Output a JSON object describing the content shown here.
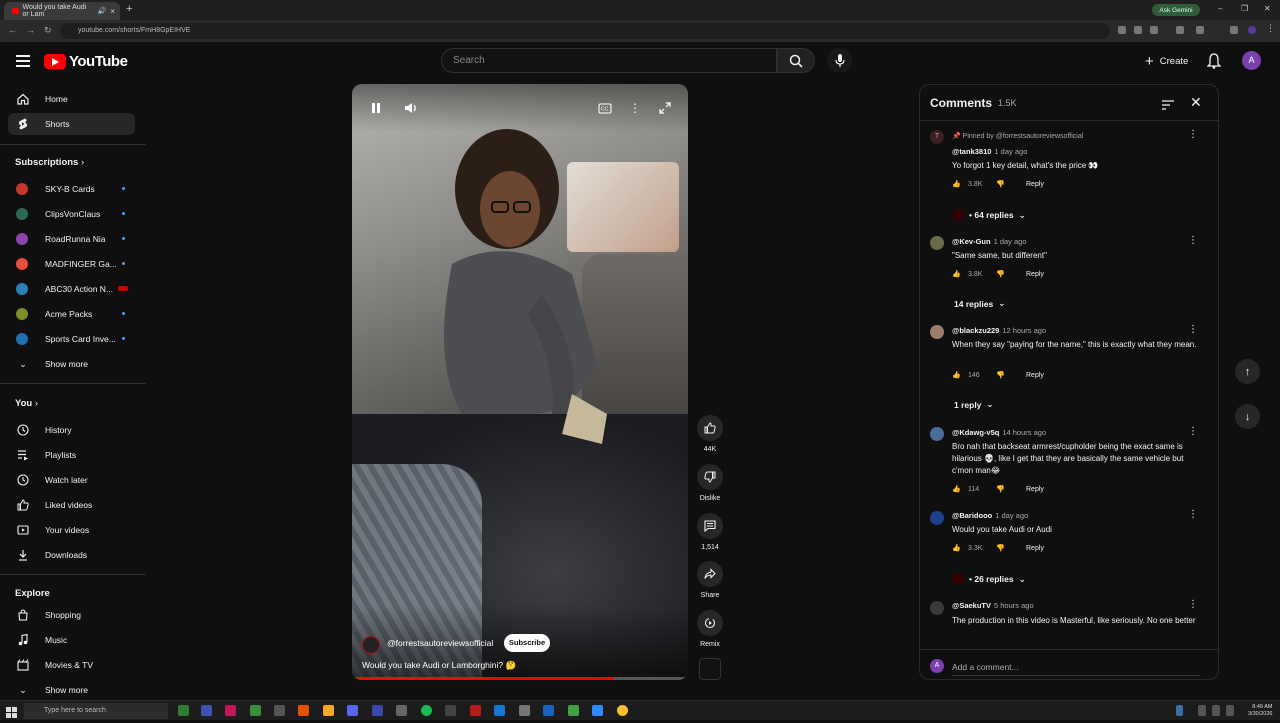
{
  "browser": {
    "tab_title": "Would you take Audi or Lam",
    "url": "youtube.com/shorts/FmH8GpEIHVE",
    "gemini_label": "Ask Gemini"
  },
  "header": {
    "logo_text": "YouTube",
    "search_placeholder": "Search",
    "create_label": "Create",
    "avatar_letter": "A"
  },
  "sidebar": {
    "main": [
      {
        "label": "Home",
        "icon": "home-icon"
      },
      {
        "label": "Shorts",
        "icon": "shorts-icon",
        "active": true
      }
    ],
    "subscriptions_heading": "Subscriptions",
    "subscriptions": [
      {
        "name": "SKY-B Cards",
        "color": "#c0392b"
      },
      {
        "name": "ClipsVonClaus",
        "color": "#2d6a4f"
      },
      {
        "name": "RoadRunna Nia",
        "color": "#8e44ad"
      },
      {
        "name": "MADFINGER Ga...",
        "color": "#e74c3c"
      },
      {
        "name": "ABC30 Action N...",
        "color": "#2980b9",
        "live": true
      },
      {
        "name": "Acme Packs",
        "color": "#7f8c2a"
      },
      {
        "name": "Sports Card Inve...",
        "color": "#1f6fb2"
      }
    ],
    "subs_show_more": "Show more",
    "you_heading": "You",
    "you_items": [
      {
        "label": "History",
        "icon": "history-icon"
      },
      {
        "label": "Playlists",
        "icon": "playlists-icon"
      },
      {
        "label": "Watch later",
        "icon": "watch-later-icon"
      },
      {
        "label": "Liked videos",
        "icon": "liked-videos-icon"
      },
      {
        "label": "Your videos",
        "icon": "your-videos-icon"
      },
      {
        "label": "Downloads",
        "icon": "downloads-icon"
      }
    ],
    "explore_heading": "Explore",
    "explore_items": [
      {
        "label": "Shopping",
        "icon": "shopping-icon"
      },
      {
        "label": "Music",
        "icon": "music-icon"
      },
      {
        "label": "Movies & TV",
        "icon": "movies-icon"
      }
    ],
    "explore_show_more": "Show more"
  },
  "video": {
    "channel": "@forrestsautoreviewsofficial",
    "subscribe_label": "Subscribe",
    "title": "Would you take Audi or Lamborghini? 🤔",
    "progress": 0.78
  },
  "actions": {
    "like_count": "44K",
    "dislike_label": "Dislike",
    "comment_count": "1,514",
    "share_label": "Share",
    "remix_label": "Remix"
  },
  "comments": {
    "heading": "Comments",
    "count": "1.5K",
    "pinned_label": "Pinned by @forrestsautoreviewsofficial",
    "items": [
      {
        "user": "@tank3810",
        "time": "1 day ago",
        "text": "Yo forgot 1 key detail, what's the price 👀",
        "likes": "3.8K",
        "replies": "• 64 replies",
        "avatar_color": "#5a2a2a",
        "avatar_letter": "T"
      },
      {
        "user": "@Kev-Gun",
        "time": "1 day ago",
        "text": "\"Same same, but different\"",
        "likes": "3.8K",
        "replies": "14 replies",
        "avatar_color": "#6b6b4a"
      },
      {
        "user": "@blackzu229",
        "time": "12 hours ago",
        "text": "When they say \"paying for the name,\" this is exactly what they mean.",
        "likes": "146",
        "replies": "1 reply",
        "avatar_color": "#9a7d6a"
      },
      {
        "user": "@Kdawg-v5q",
        "time": "14 hours ago",
        "text": "Bro nah that backseat armrest/cupholder being the exact same is hilarious 💀, like I get that they are basically the same vehicle but c'mon man😂",
        "likes": "114",
        "avatar_color": "#4a6c9a"
      },
      {
        "user": "@Baridooo",
        "time": "1 day ago",
        "text": "Would you take Audi or Audi",
        "likes": "3.3K",
        "replies": "• 26 replies",
        "avatar_color": "#1e3f8a"
      },
      {
        "user": "@SaekuTV",
        "time": "5 hours ago",
        "text": "The production in this video is Masterful, like seriously. No one better",
        "avatar_color": "#3a3a3a"
      }
    ],
    "reply_label": "Reply",
    "add_placeholder": "Add a comment..."
  },
  "taskbar": {
    "search_placeholder": "Type here to search",
    "time": "8:49 AM",
    "date": "3/30/2026"
  }
}
